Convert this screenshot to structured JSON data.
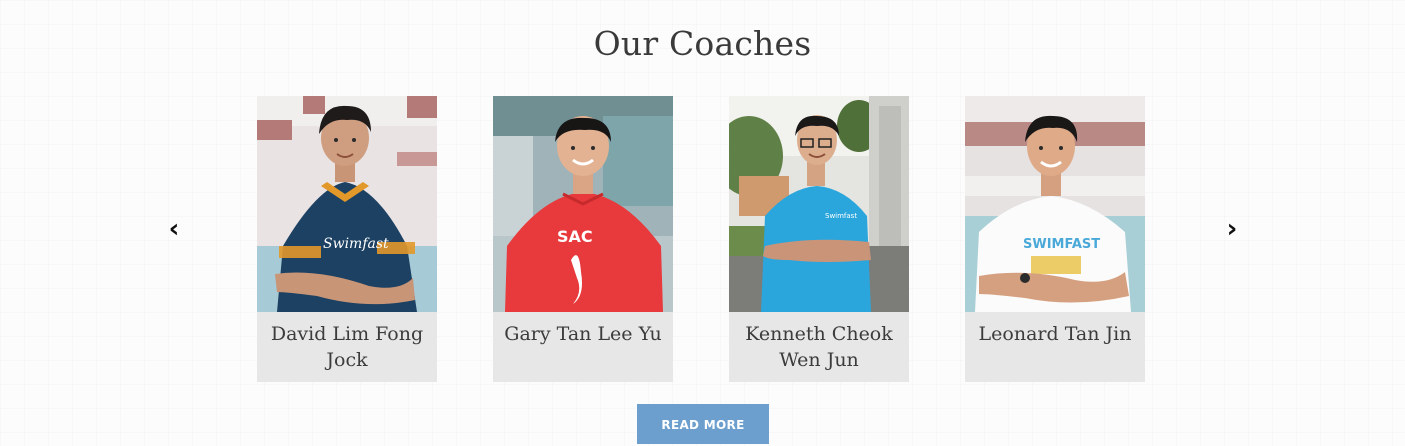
{
  "section": {
    "title": "Our Coaches"
  },
  "carousel": {
    "prev_glyph": "‹",
    "next_glyph": "›",
    "coaches": [
      {
        "name": "David Lim Fong Jock",
        "shirt_text": "Swimfast"
      },
      {
        "name": "Gary Tan Lee Yu",
        "shirt_text": "SAC"
      },
      {
        "name": "Kenneth Cheok Wen Jun",
        "shirt_text": "Swimfast"
      },
      {
        "name": "Leonard Tan Jin",
        "shirt_text": "SWIMFAST"
      }
    ]
  },
  "cta": {
    "label": "READ MORE"
  },
  "colors": {
    "accent": "#6c9fcd",
    "name_box": "#e7e7e7",
    "title_text": "#3a3a3a"
  },
  "icons": {
    "prev": "chevron-left-icon",
    "next": "chevron-right-icon"
  }
}
